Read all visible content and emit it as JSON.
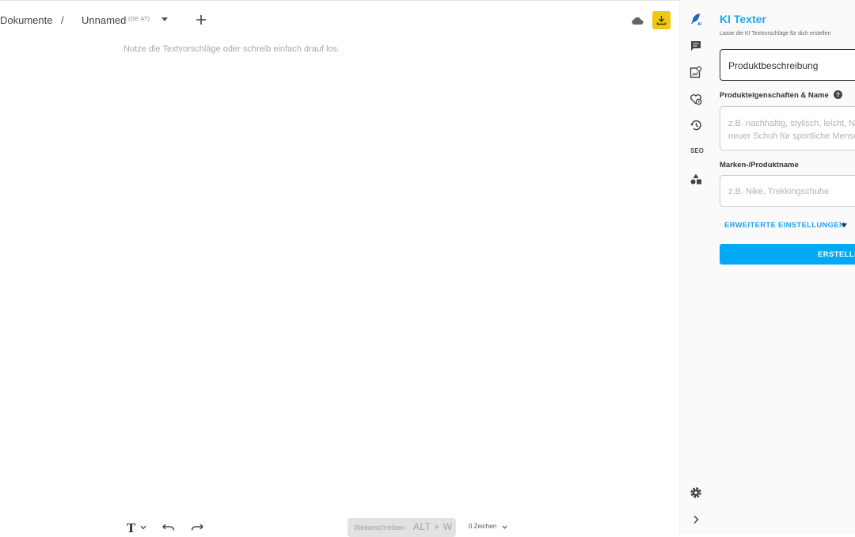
{
  "header": {
    "breadcrumb_root": "Dokumente",
    "separator": "/",
    "document_name": "Unnamed",
    "language_tag": "(DE-AT)"
  },
  "editor": {
    "placeholder": "Nutze die Textvorschläge oder schreib einfach drauf los."
  },
  "toolbar": {
    "format_label": "T",
    "continue_label": "Weiterschreiben",
    "continue_shortcut": "ALT + W",
    "char_count": "0 Zeichen"
  },
  "rail": {
    "seo_label": "SEO"
  },
  "panel": {
    "title": "KI Texter",
    "subtitle": "Lasse die KI Textvorschläge für dich erstellen",
    "text_type": "Produktbeschreibung",
    "properties_label": "Produkteigenschaften & Name",
    "properties_placeholder_1": "z.B. nachhaltig, stylisch, leicht, Nike",
    "properties_placeholder_2": "neuer Schuh für sportliche Menschen",
    "brand_label": "Marken-/Produktname",
    "brand_placeholder": "z.B. Nike, Trekkingschuhe",
    "advanced_settings": "ERWEITERTE EINSTELLUNGEN",
    "create_button": "ERSTELLEN"
  },
  "colors": {
    "accent": "#03a9f4",
    "title_blue": "#1ea7f4",
    "download_yellow": "#f2c70f"
  }
}
